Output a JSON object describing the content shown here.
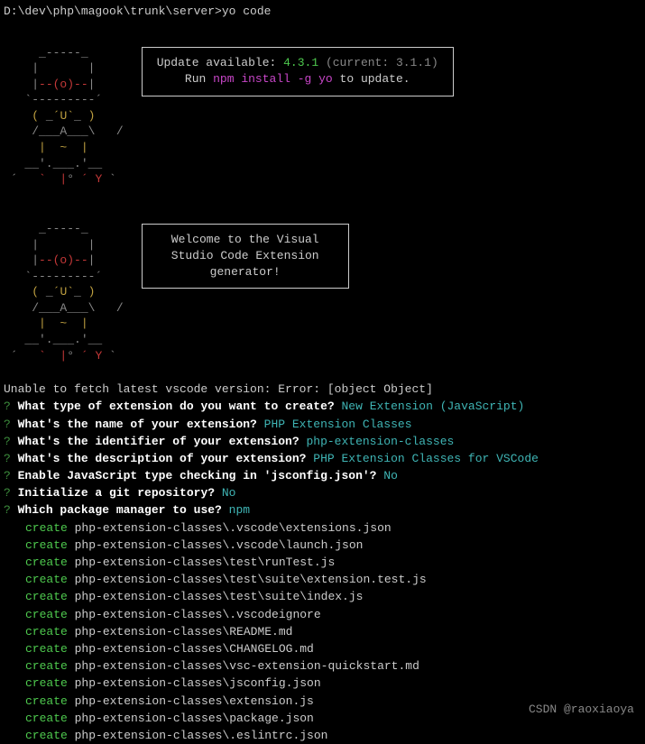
{
  "prompt": "D:\\dev\\php\\magook\\trunk\\server>yo code",
  "ascii": {
    "line1": "     _-----_     ",
    "line2": "    |       |    ",
    "line3_a": "    |",
    "line3_b": "--(o)--",
    "line3_c": "|    ",
    "line4": "   `---------´   ",
    "line5_a": "    ",
    "line5_b": "( ",
    "line5_c": "_",
    "line5_d": "´U`",
    "line5_e": "_",
    "line5_f": " )",
    "line5_g": "    ",
    "line6": "    /___A___\\   /",
    "line7_a": "     ",
    "line7_b": "|  ~  |",
    "line7_c": "     ",
    "line8": "   __'.___.'__   ",
    "line9_a": " ´   ",
    "line9_b": "`  |",
    "line9_c": "° ",
    "line9_d": "´ Y",
    "line9_e": " ` "
  },
  "update_box": {
    "line1_a": "Update available: ",
    "line1_b": "4.3.1",
    "line1_c": " (current: 3.1.1)",
    "line2_a": "Run ",
    "line2_b": "npm install -g yo",
    "line2_c": " to update."
  },
  "welcome_box": {
    "line1": "Welcome to the Visual",
    "line2": "Studio Code Extension",
    "line3": "generator!"
  },
  "error": "Unable to fetch latest vscode version: Error: [object Object]",
  "questions": [
    {
      "q": "What type of extension do you want to create?",
      "a": "New Extension (JavaScript)"
    },
    {
      "q": "What's the name of your extension?",
      "a": "PHP Extension Classes"
    },
    {
      "q": "What's the identifier of your extension?",
      "a": "php-extension-classes"
    },
    {
      "q": "What's the description of your extension?",
      "a": "PHP Extension Classes for VSCode"
    },
    {
      "q": "Enable JavaScript type checking in 'jsconfig.json'?",
      "a": "No"
    },
    {
      "q": "Initialize a git repository?",
      "a": "No"
    },
    {
      "q": "Which package manager to use?",
      "a": "npm"
    }
  ],
  "create_label": "create",
  "created_files": [
    "php-extension-classes\\.vscode\\extensions.json",
    "php-extension-classes\\.vscode\\launch.json",
    "php-extension-classes\\test\\runTest.js",
    "php-extension-classes\\test\\suite\\extension.test.js",
    "php-extension-classes\\test\\suite\\index.js",
    "php-extension-classes\\.vscodeignore",
    "php-extension-classes\\README.md",
    "php-extension-classes\\CHANGELOG.md",
    "php-extension-classes\\vsc-extension-quickstart.md",
    "php-extension-classes\\jsconfig.json",
    "php-extension-classes\\extension.js",
    "php-extension-classes\\package.json",
    "php-extension-classes\\.eslintrc.json"
  ],
  "watermark": "CSDN @raoxiaoya"
}
